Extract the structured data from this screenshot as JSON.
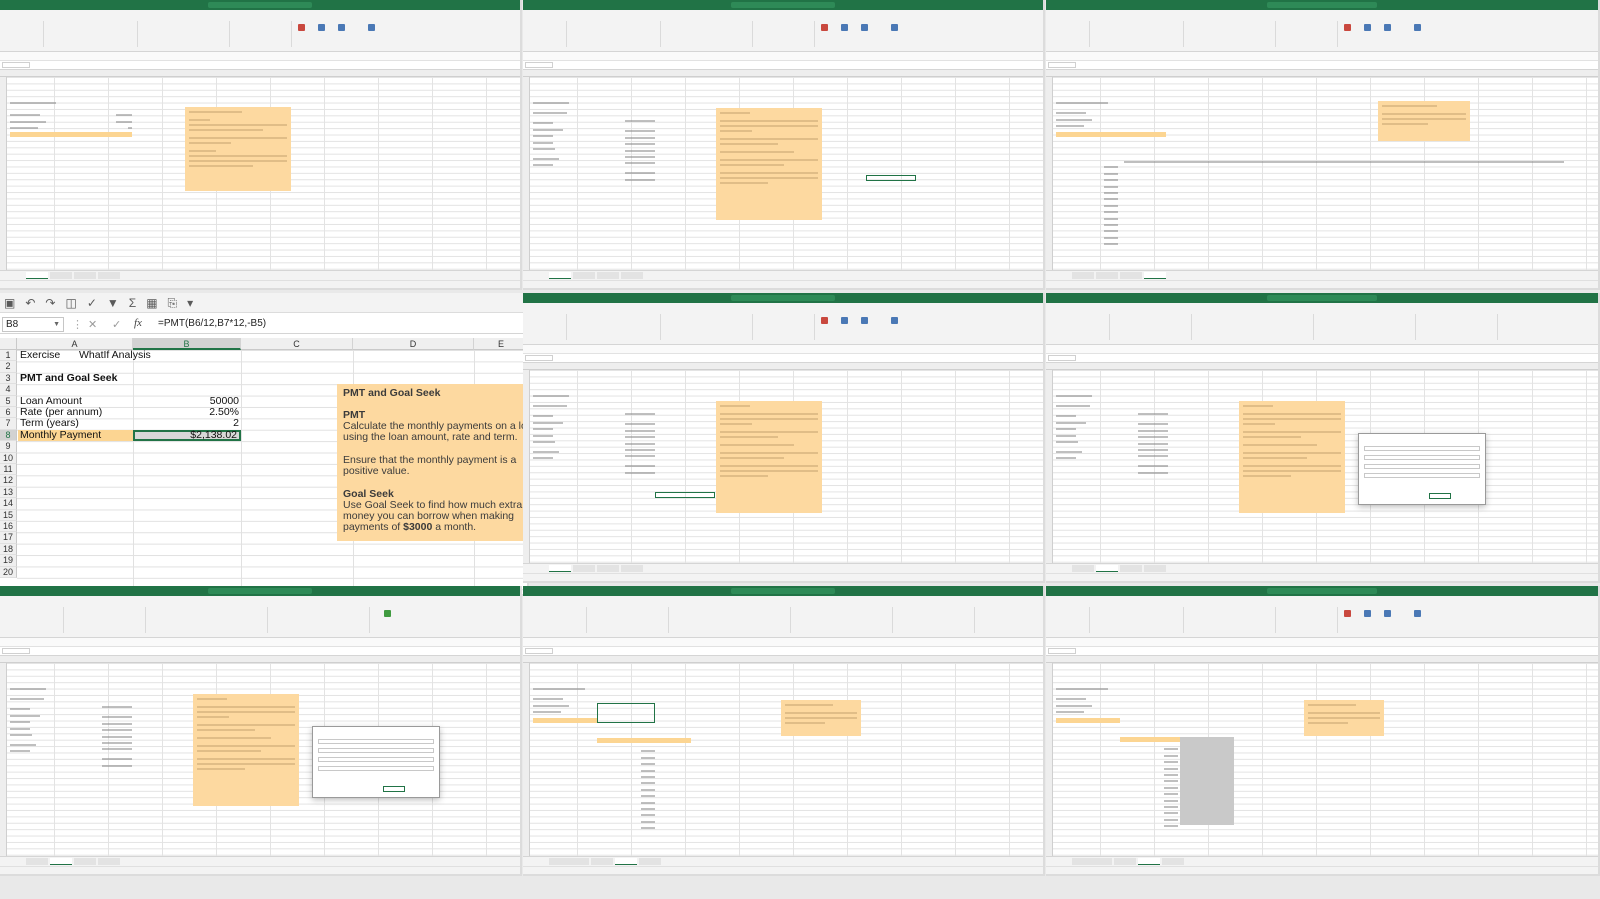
{
  "main_window": {
    "name_box": "B8",
    "formula_fx": "fx",
    "formula": "=PMT(B6/12,B7*12,-B5)",
    "columns": [
      "A",
      "B",
      "C",
      "D",
      "E"
    ],
    "rows": [
      "1",
      "2",
      "3",
      "4",
      "5",
      "6",
      "7",
      "8",
      "9",
      "10",
      "11",
      "12",
      "13",
      "14",
      "15",
      "16",
      "17",
      "18",
      "19",
      "20"
    ],
    "cells": {
      "a1": "Exercise",
      "b1": "WhatIf Analysis",
      "a3": "PMT and Goal Seek",
      "a5": "Loan Amount",
      "b5": "50000",
      "a6": "Rate (per annum)",
      "b6": "2.50%",
      "a7": "Term (years)",
      "b7": "2",
      "a8": "Monthly Payment",
      "b8": "$2,138.02"
    },
    "note": {
      "title": "PMT and Goal Seek",
      "h1": "PMT",
      "p1a": "Calculate the monthly payments on a loan",
      "p1b": "using the loan amount, rate and term.",
      "p2a": "Ensure that the monthly payment is a",
      "p2b": "positive value.",
      "h2": "Goal Seek",
      "p3a": "Use Goal Seek to find how much extra",
      "p3b": "money you can borrow when making",
      "p3c_pre": "payments of ",
      "p3c_bold": "$3000",
      "p3c_post": " a month."
    }
  },
  "colors": {
    "excel_green": "#217346",
    "note_fill": "#fdd9a0",
    "highlight_fill": "#fcd592",
    "header_gray": "#efefef"
  }
}
